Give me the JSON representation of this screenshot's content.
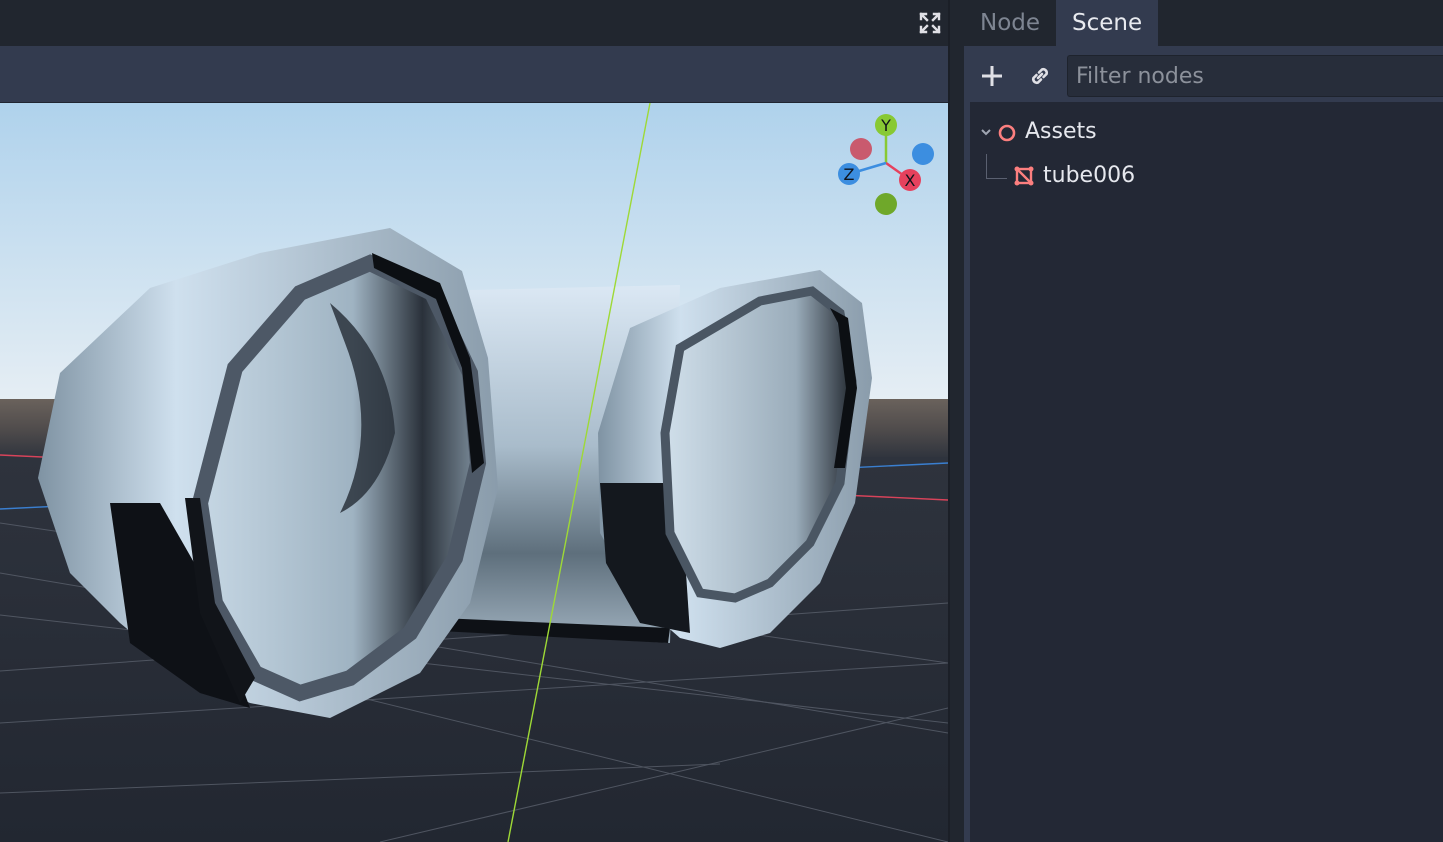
{
  "window": {
    "fullscreen_icon": "fullscreen-icon"
  },
  "viewport": {
    "gizmo": {
      "y_label": "Y",
      "x_label": "X",
      "z_label": "Z",
      "colors": {
        "x": "#e6415d",
        "y": "#88c933",
        "z": "#3c8ee0"
      }
    },
    "axis_colors": {
      "red": "#d8435a",
      "blue": "#3a7fd0",
      "green": "#9ed936"
    }
  },
  "dock": {
    "tabs": [
      {
        "label": "Node",
        "active": false
      },
      {
        "label": "Scene",
        "active": true
      }
    ],
    "add_icon": "plus-icon",
    "link_icon": "link-icon",
    "filter": {
      "placeholder": "Filter nodes",
      "value": ""
    },
    "tree": [
      {
        "label": "Assets",
        "icon": "node3d-icon",
        "expanded": true
      },
      {
        "label": "tube006",
        "icon": "mesh-instance-icon"
      }
    ]
  }
}
